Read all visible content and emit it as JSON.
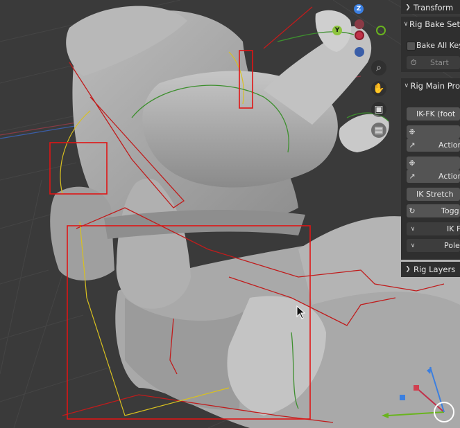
{
  "viewport": {
    "gizmo": {
      "z_label": "Z",
      "y_label": "Y"
    },
    "nav_icons": [
      "zoom-icon",
      "hand-pan-icon",
      "camera-icon",
      "grid-ortho-icon"
    ]
  },
  "sidebar": {
    "transform": {
      "label": "Transform",
      "expanded": false
    },
    "rig_bake": {
      "label": "Rig Bake Set",
      "expanded": true,
      "bake_all_label": "Bake All Key",
      "start_label": "Start"
    },
    "rig_main": {
      "label": "Rig Main Pro",
      "expanded": true,
      "ik_fk_label": "IK-FK (foot",
      "action_label_1": "Action",
      "action_label_2": "Action",
      "ik_stretch_label": "IK Stretch",
      "toggle_label": "Togg",
      "ik_sub_label": "IK F",
      "pole_label": "Pole"
    },
    "rig_layers": {
      "label": "Rig Layers",
      "expanded": false
    }
  },
  "colors": {
    "viewport_bg": "#3a3a3a",
    "panel_bg": "#2f2f2f",
    "button_bg": "#545454",
    "selection_red": "#e01515",
    "axis_x": "#e05060",
    "axis_y": "#8cc43c",
    "axis_z": "#3b7fe0"
  }
}
